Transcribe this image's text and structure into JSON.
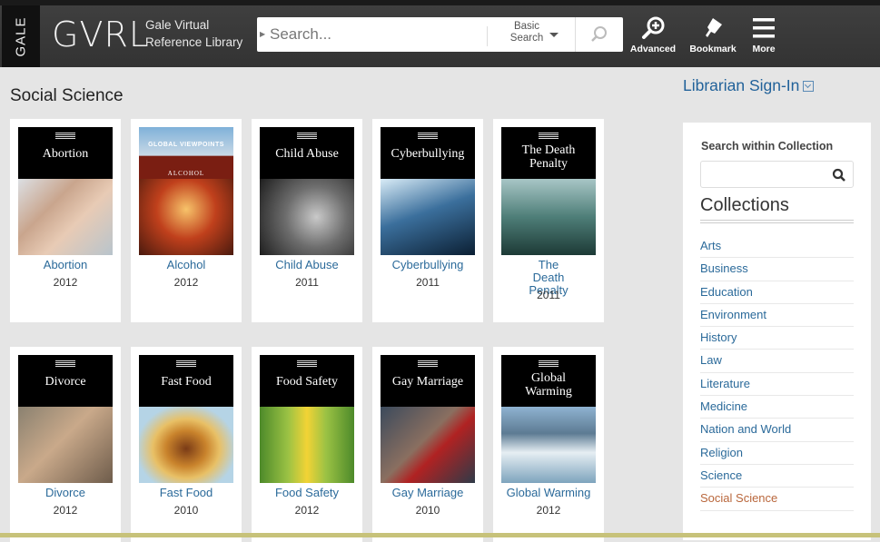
{
  "header": {
    "gale_label": "GALE",
    "logo": "GVRL",
    "logo_sub_line1": "Gale Virtual",
    "logo_sub_line2": "Reference Library",
    "search": {
      "placeholder": "Search...",
      "type_line1": "Basic",
      "type_line2": "Search",
      "submit_icon": "search-icon"
    },
    "actions": [
      {
        "label": "Advanced",
        "icon": "advanced-search-icon"
      },
      {
        "label": "Bookmark",
        "icon": "bookmark-icon"
      },
      {
        "label": "More",
        "icon": "menu-icon"
      }
    ]
  },
  "page": {
    "title": "Social Science"
  },
  "books": [
    {
      "title": "Abortion",
      "cover_title": "Abortion",
      "year": "2012"
    },
    {
      "title": "Alcohol",
      "cover_title": "ALCOHOL",
      "cover_series": "GLOBAL VIEWPOINTS",
      "year": "2012"
    },
    {
      "title": "Child Abuse",
      "cover_title": "Child Abuse",
      "year": "2011"
    },
    {
      "title": "Cyberbullying",
      "cover_title": "Cyberbullying",
      "year": "2011"
    },
    {
      "title": "The Death Penalty",
      "cover_title": "The Death Penalty",
      "year": "2011"
    },
    {
      "title": "Divorce",
      "cover_title": "Divorce",
      "year": "2012"
    },
    {
      "title": "Fast Food",
      "cover_title": "Fast Food",
      "year": "2010"
    },
    {
      "title": "Food Safety",
      "cover_title": "Food Safety",
      "year": "2012"
    },
    {
      "title": "Gay Marriage",
      "cover_title": "Gay Marriage",
      "year": "2010"
    },
    {
      "title": "Global Warming",
      "cover_title": "Global Warming",
      "year": "2012"
    }
  ],
  "sidebar": {
    "signin": "Librarian Sign-In",
    "search_label": "Search within Collection",
    "search_placeholder": "",
    "collections_title": "Collections",
    "collections": [
      "Arts",
      "Business",
      "Education",
      "Environment",
      "History",
      "Law",
      "Literature",
      "Medicine",
      "Nation and World",
      "Religion",
      "Science",
      "Social Science"
    ],
    "active_collection": "Social Science"
  },
  "colors": {
    "link": "#2b6a9a",
    "active": "#b9673c",
    "topbar": "#3a3a3a"
  }
}
